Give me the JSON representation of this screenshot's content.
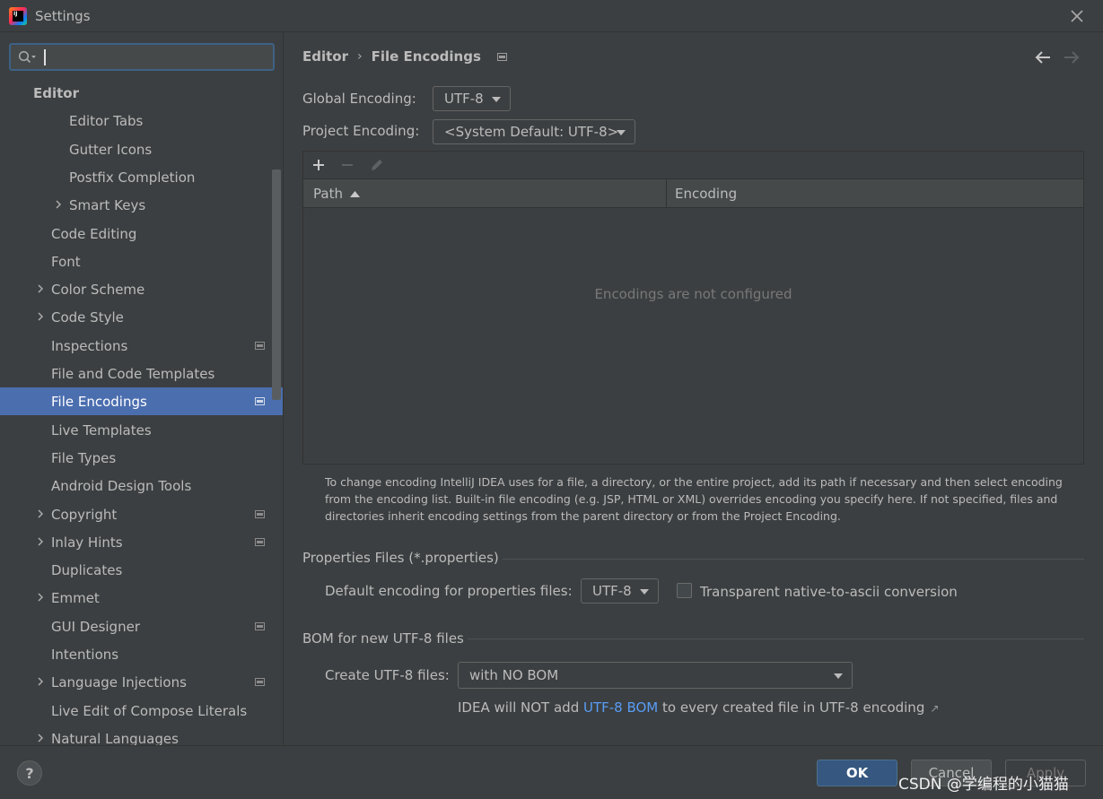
{
  "window": {
    "title": "Settings"
  },
  "search": {
    "value": ""
  },
  "sidebar": {
    "items": [
      {
        "label": "Editor",
        "has_chevron": false
      },
      {
        "label": "Editor Tabs",
        "has_chevron": false
      },
      {
        "label": "Gutter Icons",
        "has_chevron": false
      },
      {
        "label": "Postfix Completion",
        "has_chevron": false
      },
      {
        "label": "Smart Keys",
        "has_chevron": true
      },
      {
        "label": "Code Editing",
        "has_chevron": false
      },
      {
        "label": "Font",
        "has_chevron": false
      },
      {
        "label": "Color Scheme",
        "has_chevron": true
      },
      {
        "label": "Code Style",
        "has_chevron": true
      },
      {
        "label": "Inspections",
        "has_chevron": false,
        "project_icon": true
      },
      {
        "label": "File and Code Templates",
        "has_chevron": false
      },
      {
        "label": "File Encodings",
        "has_chevron": false,
        "project_icon": true,
        "selected": true
      },
      {
        "label": "Live Templates",
        "has_chevron": false
      },
      {
        "label": "File Types",
        "has_chevron": false
      },
      {
        "label": "Android Design Tools",
        "has_chevron": false
      },
      {
        "label": "Copyright",
        "has_chevron": true,
        "project_icon": true
      },
      {
        "label": "Inlay Hints",
        "has_chevron": true,
        "project_icon": true
      },
      {
        "label": "Duplicates",
        "has_chevron": false
      },
      {
        "label": "Emmet",
        "has_chevron": true
      },
      {
        "label": "GUI Designer",
        "has_chevron": false,
        "project_icon": true
      },
      {
        "label": "Intentions",
        "has_chevron": false
      },
      {
        "label": "Language Injections",
        "has_chevron": true,
        "project_icon": true
      },
      {
        "label": "Live Edit of Compose Literals",
        "has_chevron": false
      },
      {
        "label": "Natural Languages",
        "has_chevron": true
      }
    ]
  },
  "breadcrumb": {
    "parent": "Editor",
    "separator": "›",
    "current": "File Encodings"
  },
  "encoding": {
    "global_label": "Global Encoding:",
    "global_value": "UTF-8",
    "project_label": "Project Encoding:",
    "project_value": "<System Default: UTF-8>"
  },
  "table": {
    "col_path": "Path",
    "col_encoding": "Encoding",
    "empty_text": "Encodings are not configured"
  },
  "help_text": "To change encoding IntelliJ IDEA uses for a file, a directory, or the entire project, add its path if necessary and then select encoding from the encoding list. Built-in file encoding (e.g. JSP, HTML or XML) overrides encoding you specify here. If not specified, files and directories inherit encoding settings from the parent directory or from the Project Encoding.",
  "properties": {
    "section_title": "Properties Files (*.properties)",
    "default_label": "Default encoding for properties files:",
    "default_value": "UTF-8",
    "transparent_label": "Transparent native-to-ascii conversion",
    "transparent_checked": false
  },
  "bom": {
    "section_title": "BOM for new UTF-8 files",
    "create_label": "Create UTF-8 files:",
    "create_value": "with NO BOM",
    "note_prefix": "IDEA will NOT add ",
    "note_link": "UTF-8 BOM",
    "note_suffix": " to every created file in UTF-8 encoding"
  },
  "buttons": {
    "help": "?",
    "ok": "OK",
    "cancel": "Cancel",
    "apply": "Apply"
  },
  "watermark": "CSDN @学编程的小猫猫",
  "colors": {
    "selection": "#4b6eaf",
    "link": "#589df6",
    "ok_button": "#365880",
    "background": "#3c3f41"
  }
}
